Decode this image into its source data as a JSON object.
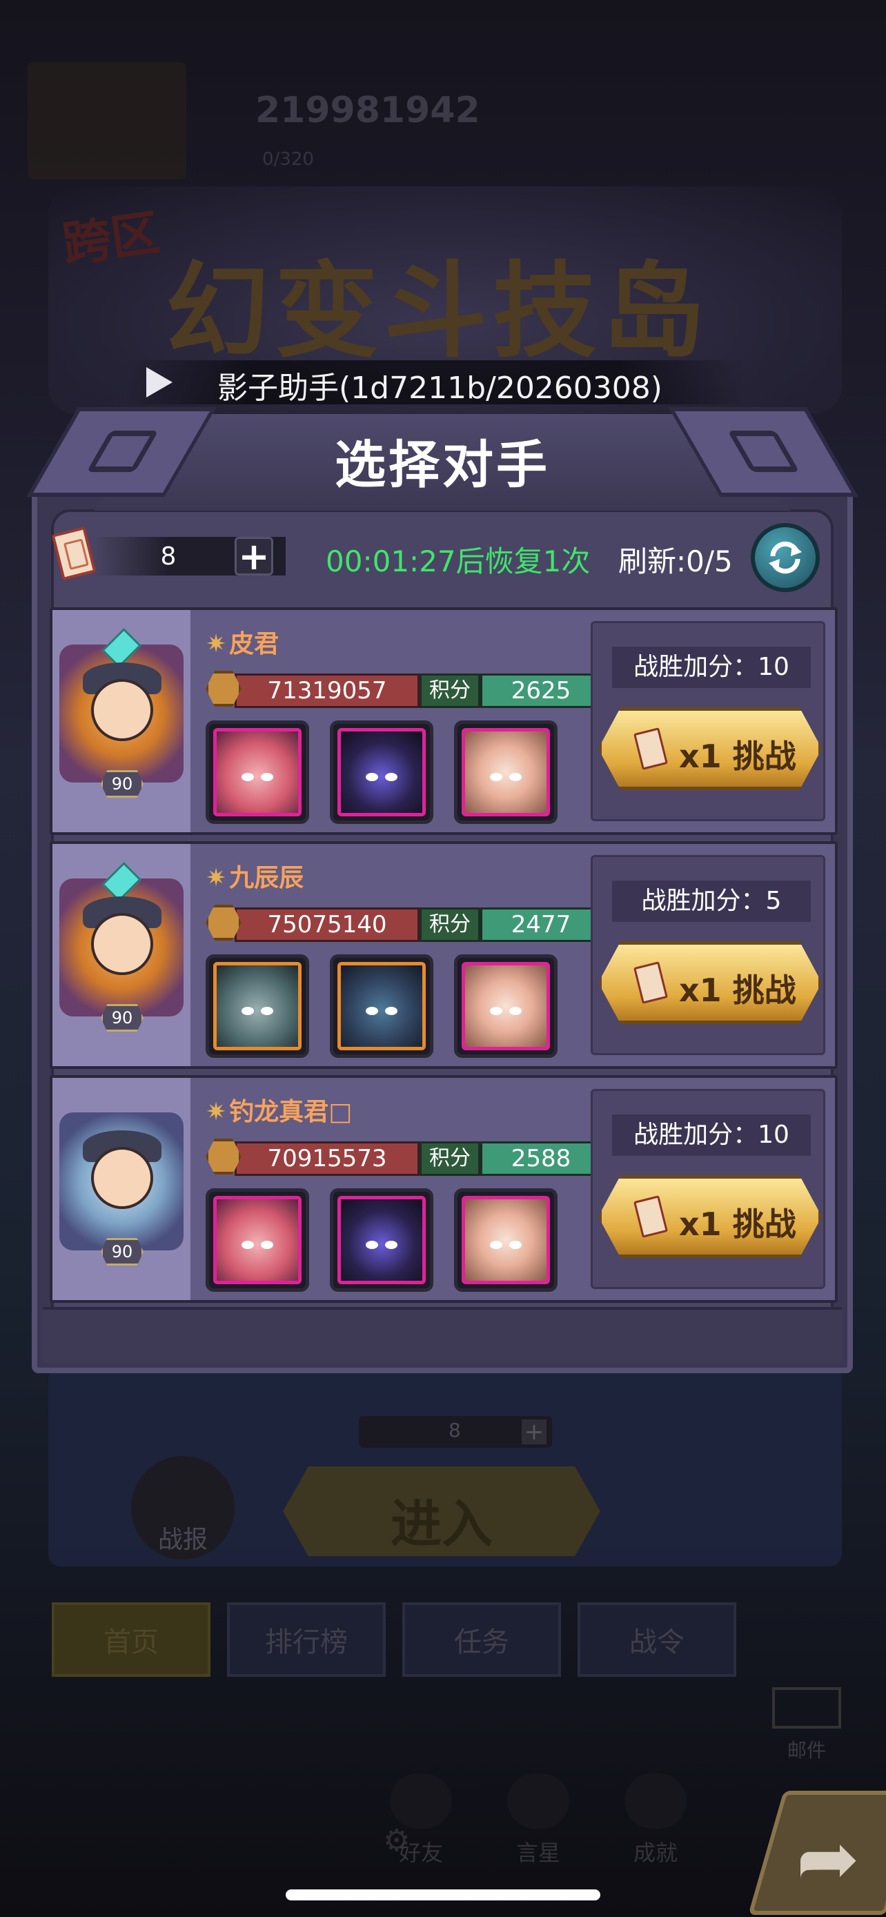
{
  "background": {
    "player_id": "219981942",
    "stamina": "0/320",
    "event_title_tag": "跨区",
    "event_title": "幻变斗技岛",
    "ticket_count": "8",
    "enter_button": "进入",
    "report_label": "战报",
    "tabs": [
      "首页",
      "排行榜",
      "任务",
      "战令"
    ],
    "mail_label": "邮件",
    "dock": [
      "好友",
      "言星",
      "成就"
    ]
  },
  "helper": {
    "text": "影子助手(1d7211b/20260308)",
    "icon": "play-icon"
  },
  "dialog": {
    "title": "选择对手",
    "ticket_count": "8",
    "recover_timer": "00:01:27后恢复1次",
    "refresh_text": "刷新:0/5",
    "colors": {
      "timer": "#3ee66b",
      "name": "#f7a35b"
    }
  },
  "opponents": [
    {
      "name": "皮君",
      "level": "90",
      "power": "71319057",
      "score_label": "积分",
      "score": "2625",
      "win_bonus": "战胜加分：10",
      "challenge_label": "x1 挑战",
      "heroes": [
        "pink",
        "dragon",
        "mask"
      ]
    },
    {
      "name": "九辰辰",
      "level": "90",
      "power": "75075140",
      "score_label": "积分",
      "score": "2477",
      "win_bonus": "战胜加分：5",
      "challenge_label": "x1 挑战",
      "heroes": [
        "wolf",
        "armor",
        "mask"
      ]
    },
    {
      "name": "钓龙真君□",
      "level": "90",
      "power": "70915573",
      "score_label": "积分",
      "score": "2588",
      "win_bonus": "战胜加分：10",
      "challenge_label": "x1 挑战",
      "heroes": [
        "pink",
        "dragon",
        "mask"
      ]
    }
  ]
}
